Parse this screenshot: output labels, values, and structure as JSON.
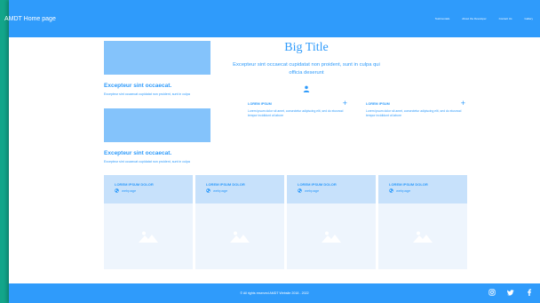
{
  "header": {
    "brand": "AMDT Home page",
    "nav": [
      "Testimonials",
      "About the Developer",
      "Contact Us",
      "Gallery"
    ]
  },
  "left_blocks": [
    {
      "title": "Excepteur sint occaecat.",
      "text": "Excepteur sint occaecat cupidatat non proident, sunt in culpa"
    },
    {
      "title": "Excepteur sint occaecat.",
      "text": "Excepteur sint occaecat cupidatat non proident, sunt in culpa"
    }
  ],
  "hero": {
    "title": "Big Title",
    "subtitle": "Excepteur sint occaecat cupidatat non proident, sunt in culpa qui officia deserunt",
    "user_icon": "user-icon"
  },
  "faq": [
    {
      "title": "LOREM IPSUM",
      "text": "Lorem ipsum dolor sit amet, consectetur adipiscing elit, sed do eiusmod tempor incididunt ut labore"
    },
    {
      "title": "LOREM IPSUM",
      "text": "Lorem ipsum dolor sit amet, consectetur adipiscing elit, sed do eiusmod tempor incididunt ut labore"
    }
  ],
  "cards": [
    {
      "title": "LOREM IPSUM DOLOR",
      "link": "webpage"
    },
    {
      "title": "LOREM IPSUM DOLOR",
      "link": "webpage"
    },
    {
      "title": "LOREM IPSUM DOLOR",
      "link": "webpage"
    },
    {
      "title": "LOREM IPSUM DOLOR",
      "link": "webpage"
    }
  ],
  "footer": {
    "copyright": "© All rights reserved AMDT Website 2018 - 2022",
    "social": [
      "instagram-icon",
      "twitter-icon",
      "facebook-icon"
    ]
  },
  "colors": {
    "accent": "#2f9bfb",
    "light_accent": "#84c3fb",
    "card_head": "#c7e1fb",
    "card_body": "#eef5fd",
    "outer_bg": "#12a58a"
  }
}
